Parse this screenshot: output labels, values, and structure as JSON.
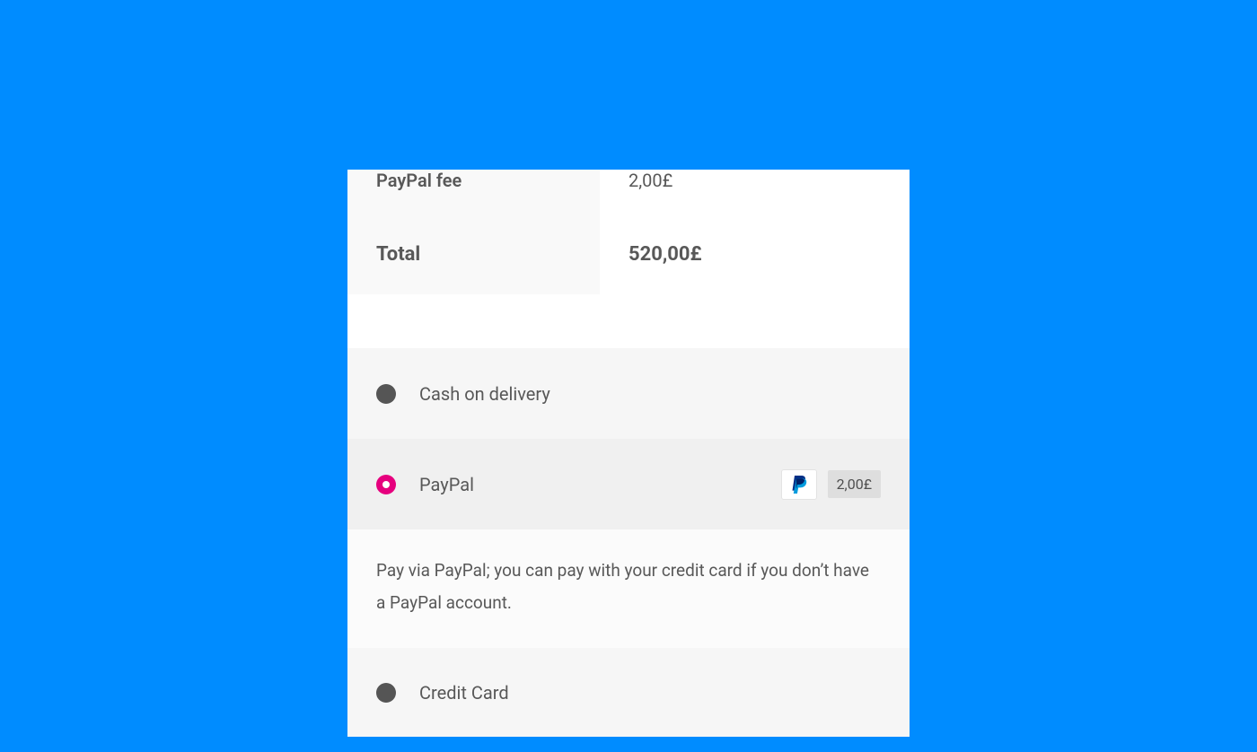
{
  "summary": {
    "fee_label": "PayPal fee",
    "fee_value": "2,00£",
    "total_label": "Total",
    "total_value": "520,00£"
  },
  "payment_methods": {
    "cod_label": "Cash on delivery",
    "paypal_label": "PayPal",
    "paypal_fee_tag": "2,00£",
    "paypal_description": "Pay via PayPal; you can pay with your credit card if you don’t have a PayPal account.",
    "credit_card_label": "Credit Card"
  }
}
